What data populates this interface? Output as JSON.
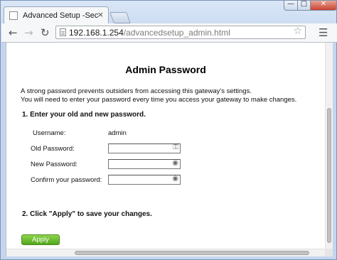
{
  "browser": {
    "tab_title": "Advanced Setup -Security",
    "tab_close": "×",
    "url_host": "192.168.1.254",
    "url_path": "/advancedsetup_admin.html",
    "nav_back": "←",
    "nav_forward": "→",
    "nav_reload": "↻",
    "bookmark_star": "☆",
    "menu": "☰",
    "window_min": "—",
    "window_max": "□",
    "window_close": "✕"
  },
  "page": {
    "heading": "Admin Password",
    "intro_line1": "A strong password prevents outsiders from accessing this gateway's settings.",
    "intro_line2": "You will need to enter your password every time you access your gateway to make changes.",
    "step1": "1. Enter your old and new password.",
    "username_label": "Username:",
    "username_value": "admin",
    "old_password_label": "Old Password:",
    "new_password_label": "New Password:",
    "confirm_password_label": "Confirm your password:",
    "old_password_value": "",
    "new_password_value": "",
    "confirm_password_value": "",
    "step2": "2. Click \"Apply\" to save your changes.",
    "apply_label": "Apply"
  },
  "icons": {
    "page": "page-icon",
    "key_field": "key-icon",
    "eye_field": "password-eye-icon"
  },
  "colors": {
    "apply_button": "#5fb02a",
    "window_close": "#c8432f"
  }
}
